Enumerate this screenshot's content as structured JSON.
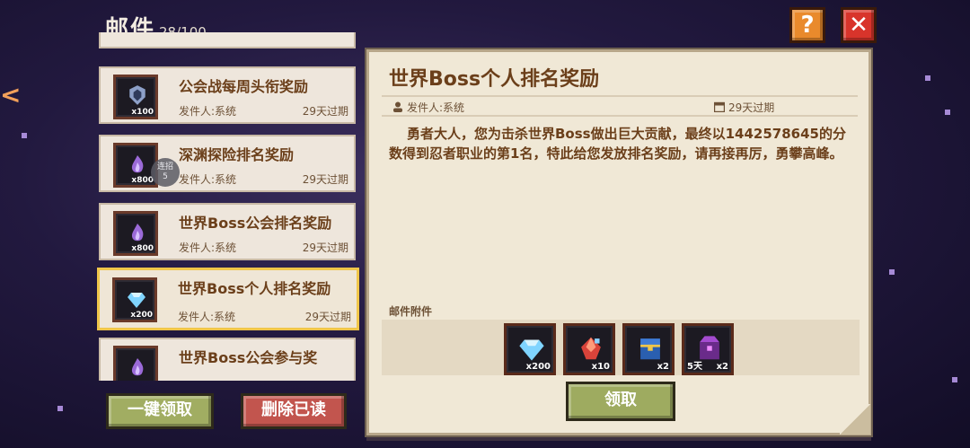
{
  "header": {
    "title": "邮件",
    "count": "28/100",
    "help_icon": "?",
    "close_icon": "✕"
  },
  "edge_glyph": "<",
  "mail_list": [
    {
      "subject": "公会战每周头衔奖励",
      "sender": "发件人:系统",
      "expire": "29天过期",
      "qty": "x100",
      "icon": "guild-crest-icon"
    },
    {
      "subject": "深渊探险排名奖励",
      "sender": "发件人:系统",
      "expire": "29天过期",
      "qty": "x800",
      "icon": "purple-flame-icon",
      "badge": "连招\n5"
    },
    {
      "subject": "世界Boss公会排名奖励",
      "sender": "发件人:系统",
      "expire": "29天过期",
      "qty": "x800",
      "icon": "purple-flame-icon"
    },
    {
      "subject": "世界Boss个人排名奖励",
      "sender": "发件人:系统",
      "expire": "29天过期",
      "qty": "x200",
      "icon": "diamond-icon",
      "selected": true
    },
    {
      "subject": "世界Boss公会参与奖",
      "icon": "purple-flame-icon"
    }
  ],
  "buttons": {
    "claim_all": "一键领取",
    "delete_read": "删除已读",
    "claim": "领取"
  },
  "detail": {
    "title": "世界Boss个人排名奖励",
    "sender": "发件人:系统",
    "expire": "29天过期",
    "body": "勇者大人，您为击杀世界Boss做出巨大贡献，最终以1442578645的分数得到忍者职业的第1名，特此给您发放排名奖励，请再接再厉，勇攀高峰。",
    "attachments_label": "邮件附件",
    "attachments": [
      {
        "icon": "diamond-icon",
        "qty": "x200"
      },
      {
        "icon": "red-crystal-icon",
        "qty": "x10"
      },
      {
        "icon": "treasure-chest-icon",
        "qty": "x2"
      },
      {
        "icon": "purple-chest-icon",
        "qty": "x2",
        "duration": "5天"
      }
    ]
  },
  "colors": {
    "accent_gold": "#f0c64a",
    "claim_green": "#9eab60",
    "delete_red": "#c2554e",
    "close_red": "#d8342b",
    "help_orange": "#e98a2c",
    "text_brown": "#6b3f1a"
  }
}
